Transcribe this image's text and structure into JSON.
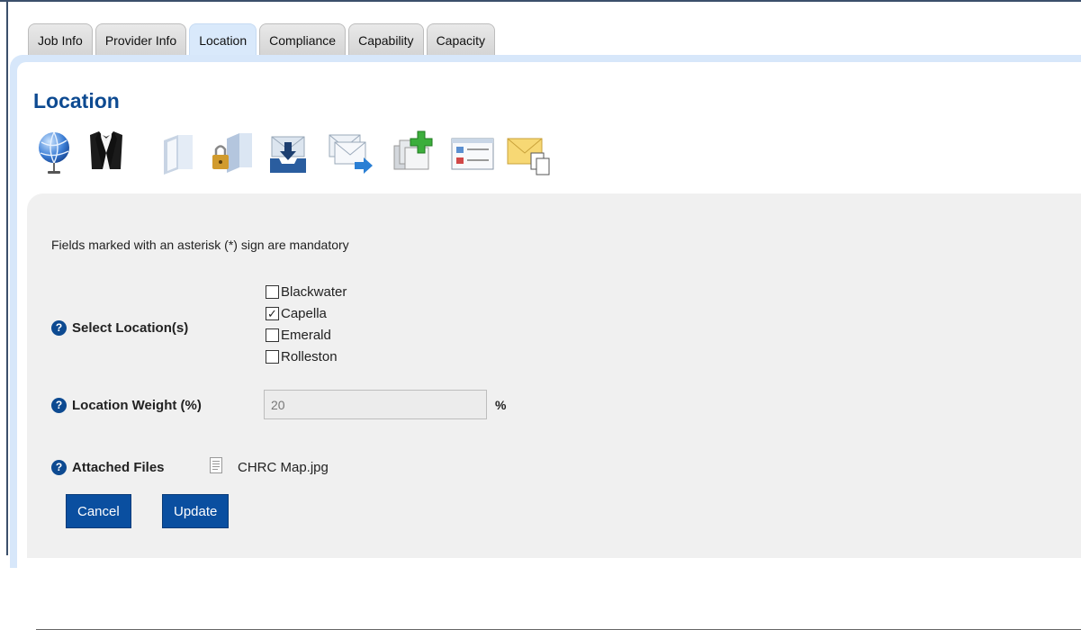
{
  "tabs": [
    {
      "label": "Job Info"
    },
    {
      "label": "Provider Info"
    },
    {
      "label": "Location"
    },
    {
      "label": "Compliance"
    },
    {
      "label": "Capability"
    },
    {
      "label": "Capacity"
    }
  ],
  "active_tab": "Location",
  "page_title": "Location",
  "toolbar_icons": [
    "globe-icon",
    "tuxedo-icon",
    "folder-icon",
    "folder-lock-icon",
    "inbox-download-icon",
    "mail-forward-icon",
    "add-copy-icon",
    "form-list-icon",
    "mail-copy-icon"
  ],
  "form": {
    "mandatory_note": "Fields marked with an asterisk (*) sign are mandatory",
    "select_location_label": "Select Location(s)",
    "locations": [
      {
        "label": "Blackwater",
        "checked": false
      },
      {
        "label": "Capella",
        "checked": true
      },
      {
        "label": "Emerald",
        "checked": false
      },
      {
        "label": "Rolleston",
        "checked": false
      }
    ],
    "weight_label": "Location Weight (%)",
    "weight_value": "20",
    "weight_unit": "%",
    "attached_files_label": "Attached Files",
    "attached_file": "CHRC Map.jpg"
  },
  "buttons": {
    "cancel": "Cancel",
    "update": "Update"
  },
  "colors": {
    "title_blue": "#0d4a91",
    "button_blue": "#0a4fa0",
    "tab_active_bg": "#d9e9fb",
    "panel_bg": "#f0f0f0"
  }
}
